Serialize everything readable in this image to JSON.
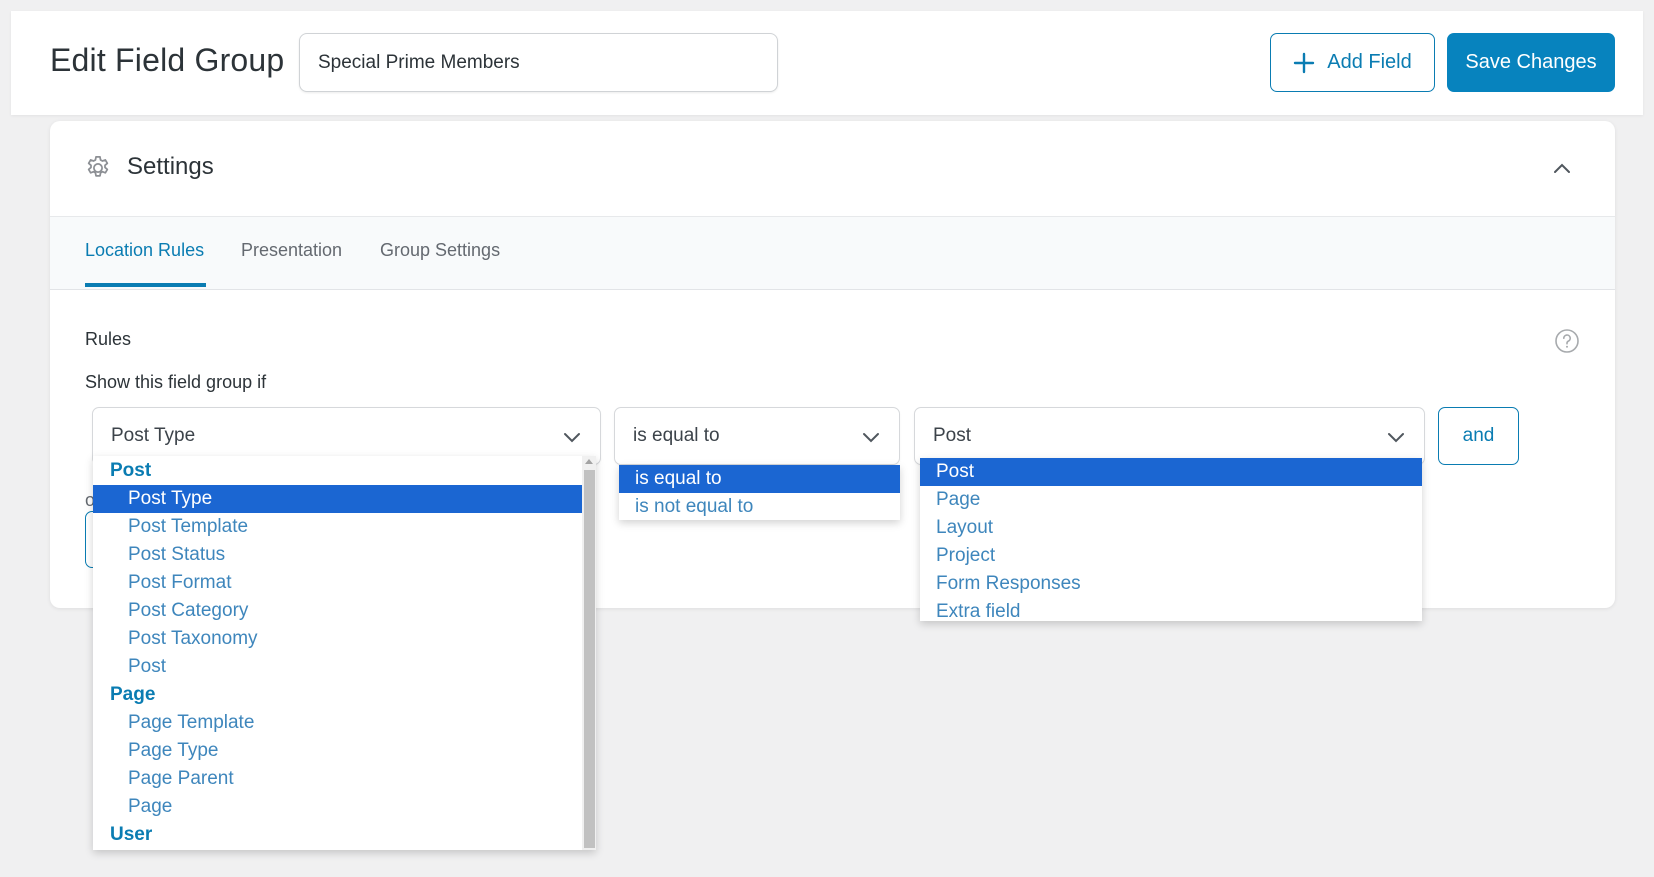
{
  "header": {
    "title": "Edit Field Group",
    "group_name_value": "Special Prime Members",
    "add_field_label": "Add Field",
    "save_label": "Save Changes"
  },
  "settings": {
    "title": "Settings",
    "tabs": [
      {
        "label": "Location Rules",
        "active": true
      },
      {
        "label": "Presentation",
        "active": false
      },
      {
        "label": "Group Settings",
        "active": false
      }
    ],
    "rules_label": "Rules",
    "show_if_label": "Show this field group if",
    "or_label": "or",
    "rule": {
      "param_value": "Post Type",
      "operator_value": "is equal to",
      "value_value": "Post",
      "and_label": "and"
    }
  },
  "dropdowns": {
    "param": {
      "items": [
        {
          "label": "Post",
          "type": "group"
        },
        {
          "label": "Post Type",
          "type": "child",
          "selected": true
        },
        {
          "label": "Post Template",
          "type": "child"
        },
        {
          "label": "Post Status",
          "type": "child"
        },
        {
          "label": "Post Format",
          "type": "child"
        },
        {
          "label": "Post Category",
          "type": "child"
        },
        {
          "label": "Post Taxonomy",
          "type": "child"
        },
        {
          "label": "Post",
          "type": "child"
        },
        {
          "label": "Page",
          "type": "group"
        },
        {
          "label": "Page Template",
          "type": "child"
        },
        {
          "label": "Page Type",
          "type": "child"
        },
        {
          "label": "Page Parent",
          "type": "child"
        },
        {
          "label": "Page",
          "type": "child"
        },
        {
          "label": "User",
          "type": "group"
        }
      ]
    },
    "operator": {
      "items": [
        {
          "label": "is equal to",
          "selected": true
        },
        {
          "label": "is not equal to"
        }
      ]
    },
    "value": {
      "items": [
        {
          "label": "Post",
          "selected": true
        },
        {
          "label": "Page"
        },
        {
          "label": "Layout"
        },
        {
          "label": "Project"
        },
        {
          "label": "Form Responses"
        },
        {
          "label": "Extra field"
        }
      ]
    }
  },
  "colors": {
    "accent": "#0a7cb2",
    "primary_button": "#0783be",
    "selection": "#1b66d2"
  }
}
